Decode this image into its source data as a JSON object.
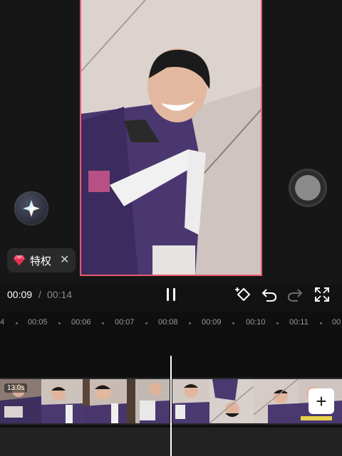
{
  "privilege_chip": {
    "label": "特权",
    "close_glyph": "✕",
    "gem_icon_color": "#ff4d6d"
  },
  "playback": {
    "current_time": "00:09",
    "separator": "/",
    "total_time": "00:14"
  },
  "timeline": {
    "ruler_labels": [
      "4",
      "00:05",
      "00:06",
      "00:07",
      "00:08",
      "00:09",
      "00:10",
      "00:11",
      "00"
    ],
    "clip_duration": "13.0s"
  },
  "add_clip_button": {
    "label": "+"
  },
  "colors": {
    "accent_border": "#ea5b72",
    "background": "#121212",
    "playhead": "#ffffff"
  },
  "icons": [
    "ai-sparkle-icon",
    "record-icon",
    "gem-icon",
    "close-icon",
    "pause-icon",
    "keyframe-icon",
    "undo-icon",
    "redo-icon",
    "fullscreen-icon",
    "plus-icon"
  ]
}
